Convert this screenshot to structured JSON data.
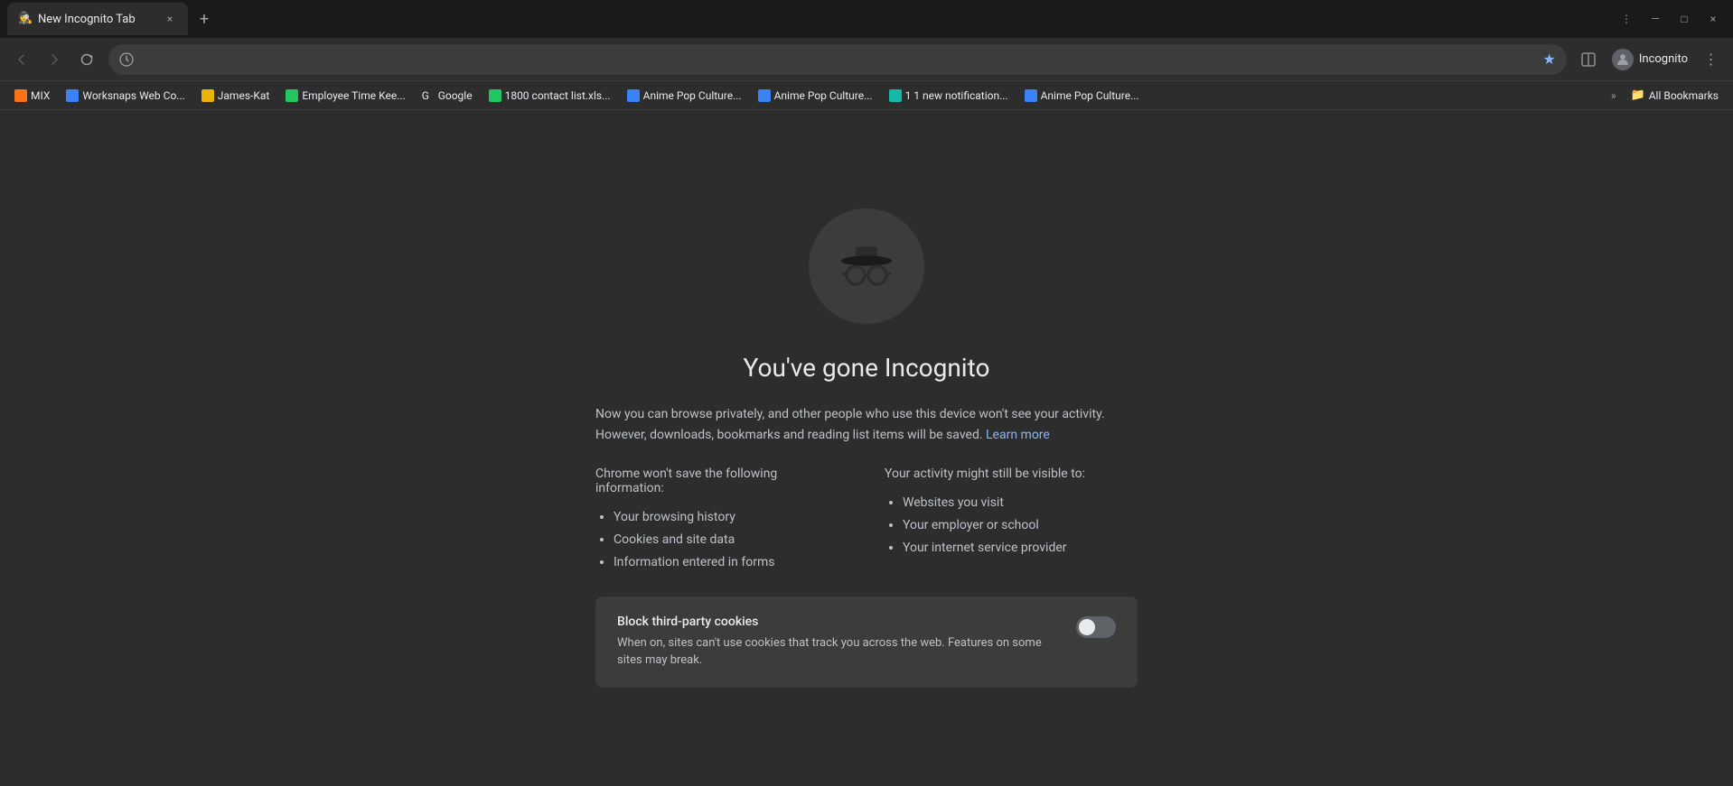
{
  "tab": {
    "title": "New Incognito Tab",
    "favicon": "🕵",
    "close_label": "×"
  },
  "tab_new_label": "+",
  "window_controls": {
    "minimize": "—",
    "maximize": "□",
    "close": "×",
    "tabs_btn": "⋮"
  },
  "toolbar": {
    "back_title": "Back",
    "forward_title": "Forward",
    "reload_title": "Reload",
    "address": "",
    "star_label": "★",
    "split_tab_label": "⧉",
    "profile_name": "Incognito",
    "menu_label": "⋮"
  },
  "bookmarks": {
    "items": [
      {
        "label": "MIX",
        "color": "bk-orange"
      },
      {
        "label": "Worksnaps Web Co...",
        "color": "bk-blue"
      },
      {
        "label": "James-Kat",
        "color": "bk-yellow"
      },
      {
        "label": "Employee Time Kee...",
        "color": "bk-green"
      },
      {
        "label": "Google",
        "color": "bk-dark"
      },
      {
        "label": "1800 contact list.xls...",
        "color": "bk-green"
      },
      {
        "label": "Anime Pop Culture...",
        "color": "bk-blue"
      },
      {
        "label": "Anime Pop Culture...",
        "color": "bk-blue"
      },
      {
        "label": "1 1 new notification...",
        "color": "bk-teal"
      },
      {
        "label": "Anime Pop Culture...",
        "color": "bk-blue"
      }
    ],
    "more_label": "»",
    "all_bookmarks_label": "All Bookmarks"
  },
  "page": {
    "title": "You've gone Incognito",
    "description_part1": "Now you can browse privately, and other people who use this device won't see your activity. However, downloads, bookmarks and reading list items will be saved.",
    "learn_more_label": "Learn more",
    "wont_save_title": "Chrome won't save the following information:",
    "wont_save_items": [
      "Your browsing history",
      "Cookies and site data",
      "Information entered in forms"
    ],
    "might_see_title": "Your activity might still be visible to:",
    "might_see_items": [
      "Websites you visit",
      "Your employer or school",
      "Your internet service provider"
    ],
    "cookie_box": {
      "title": "Block third-party cookies",
      "description": "When on, sites can't use cookies that track you across the web. Features on some sites may break.",
      "toggle_on": false
    }
  }
}
